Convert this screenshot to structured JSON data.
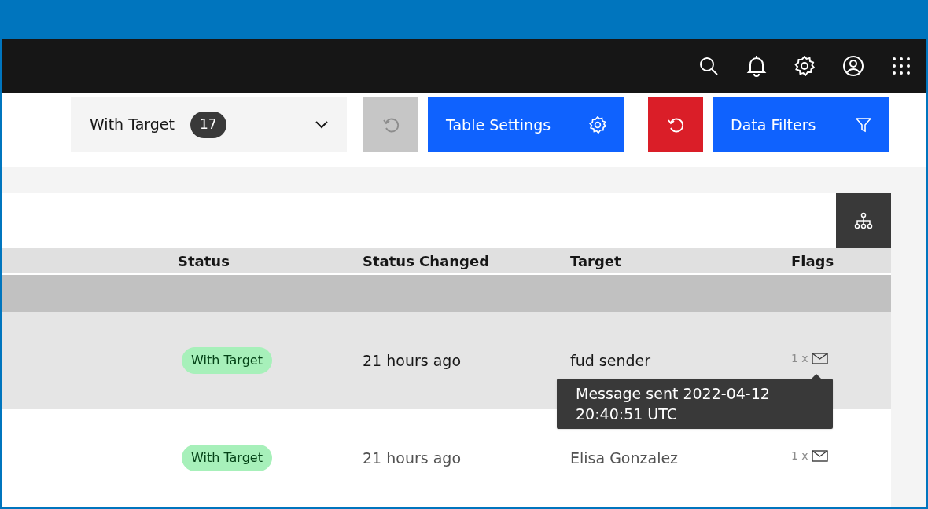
{
  "filter": {
    "label": "With Target",
    "count": "17"
  },
  "toolbar": {
    "table_settings": "Table Settings",
    "data_filters": "Data Filters"
  },
  "table": {
    "columns": [
      "Status",
      "Status Changed",
      "Target",
      "Flags"
    ],
    "rows": [
      {
        "status": "With Target",
        "changed": "21 hours ago",
        "target": "fud sender",
        "flag_count": "1 x",
        "highlighted": true,
        "tooltip": "Message sent 2022-04-12 20:40:51 UTC"
      },
      {
        "status": "With Target",
        "changed": "21 hours ago",
        "target": "Elisa Gonzalez",
        "flag_count": "1 x",
        "highlighted": false
      }
    ]
  }
}
